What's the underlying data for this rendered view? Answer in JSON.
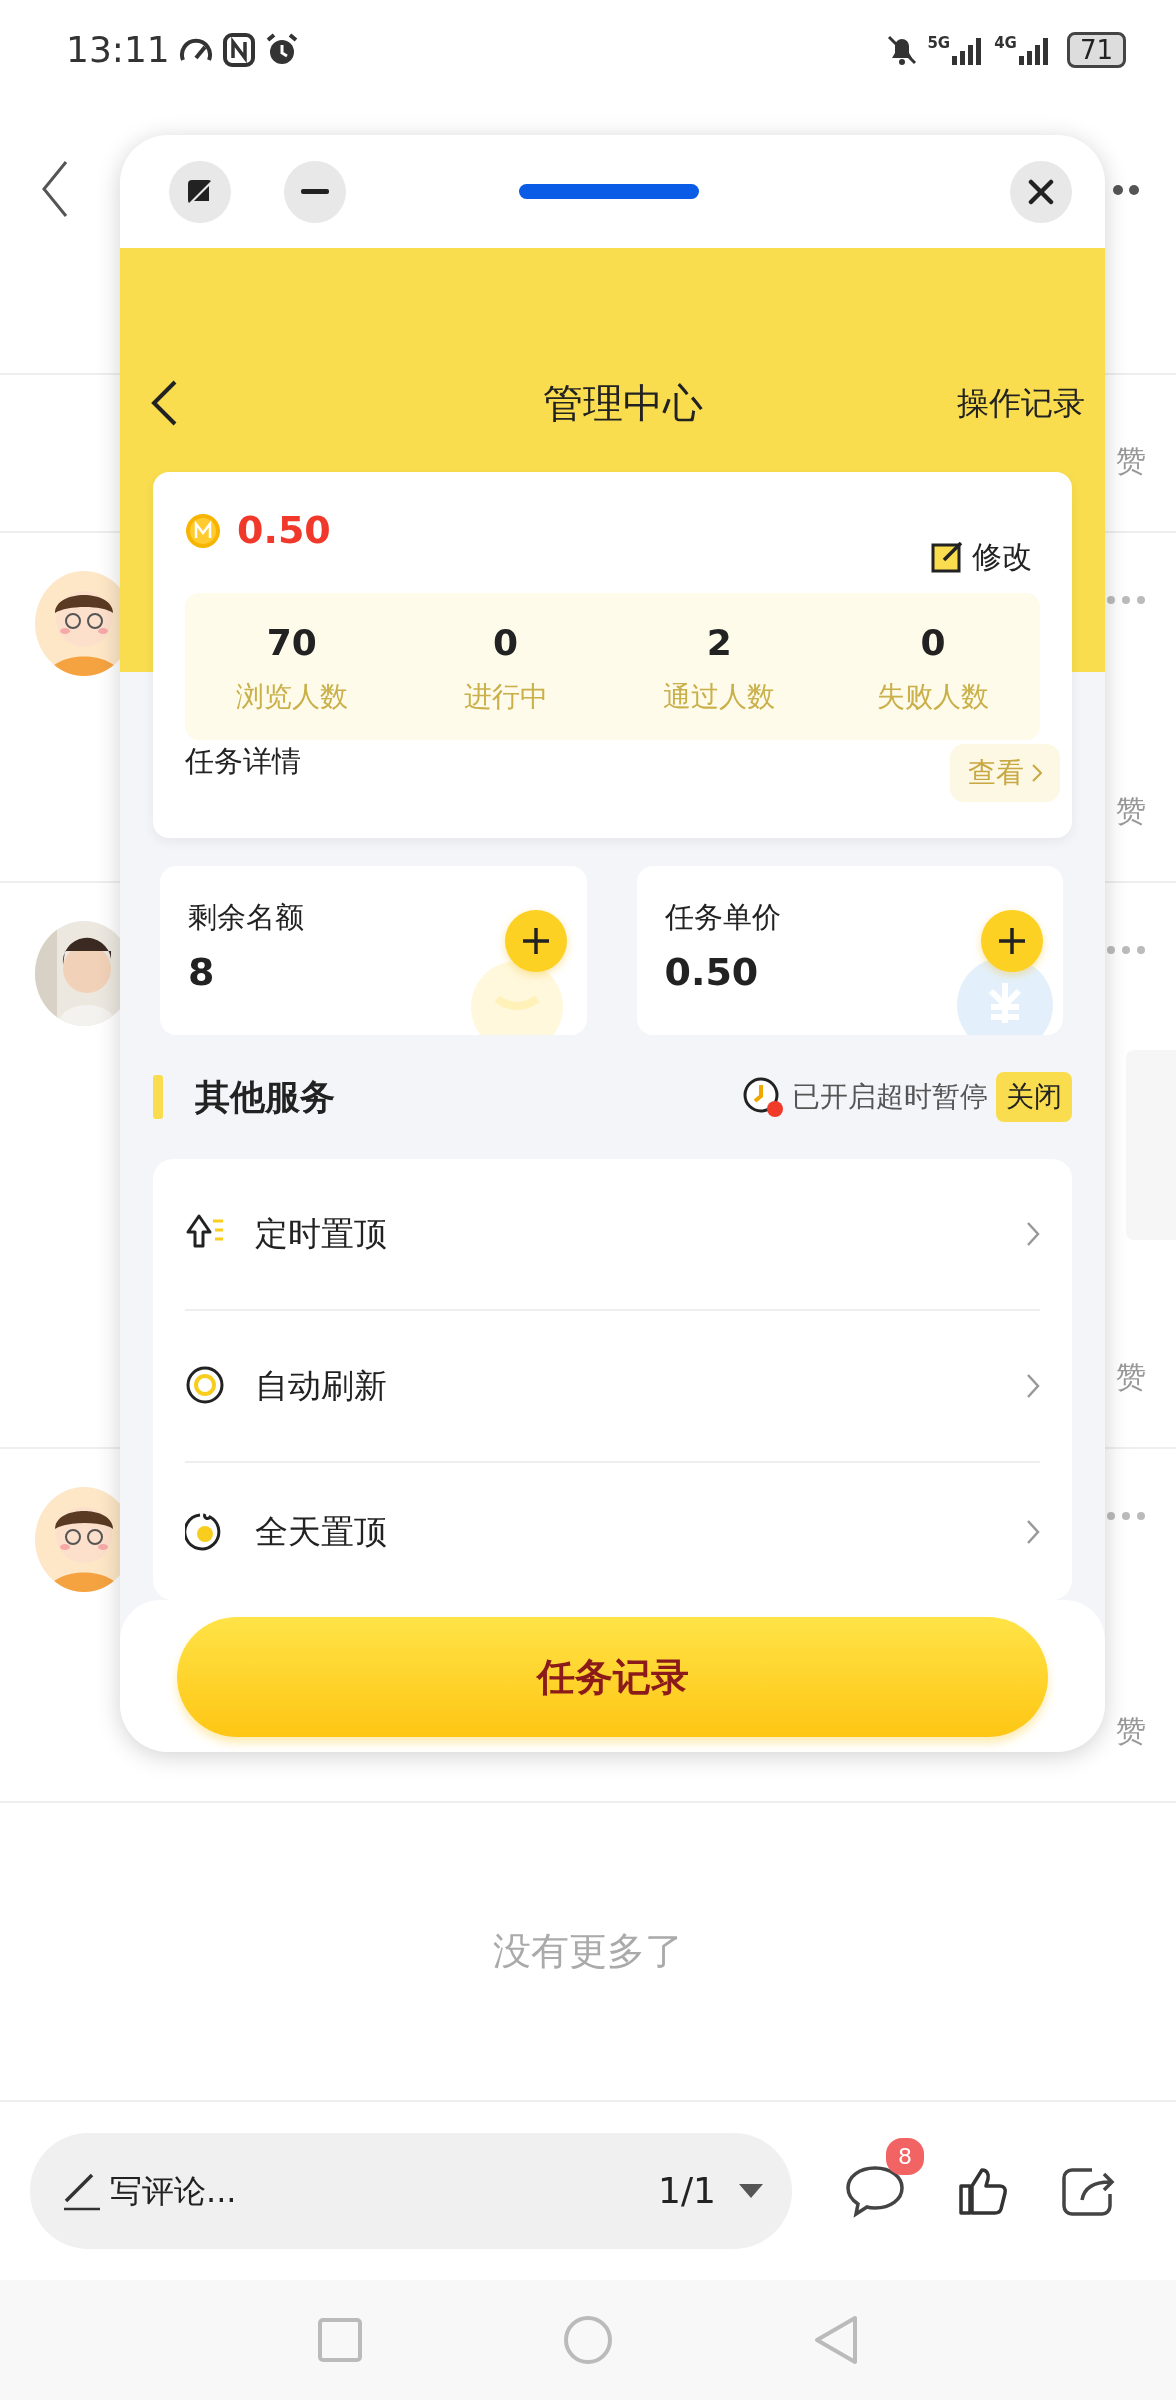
{
  "status_bar": {
    "time": "13:11",
    "network_1": "5G",
    "network_2": "4G",
    "battery": "71"
  },
  "page": {
    "posts": [
      {
        "kind": "plain",
        "like": "赞"
      },
      {
        "kind": "avatar",
        "like": "赞"
      },
      {
        "kind": "avatar",
        "like": "赞"
      },
      {
        "kind": "avatar",
        "like": "赞"
      }
    ],
    "end_text": "没有更多了"
  },
  "comment_bar": {
    "placeholder": "写评论...",
    "page": "1/1",
    "comment_count": "8"
  },
  "floating_window": {
    "title": "管理中心",
    "action": "操作记录",
    "price": "0.50",
    "edit_label": "修改",
    "stats": [
      {
        "value": "70",
        "label": "浏览人数"
      },
      {
        "value": "0",
        "label": "进行中"
      },
      {
        "value": "2",
        "label": "通过人数"
      },
      {
        "value": "0",
        "label": "失败人数"
      }
    ],
    "details_label": "任务详情",
    "view_label": "查看",
    "tiles": [
      {
        "label": "剩余名额",
        "value": "8"
      },
      {
        "label": "任务单价",
        "value": "0.50"
      }
    ],
    "section_title": "其他服务",
    "timeout_status": "已开启超时暂停",
    "timeout_action": "关闭",
    "services": [
      {
        "kind": "scheduled",
        "label": "定时置顶"
      },
      {
        "kind": "refresh",
        "label": "自动刷新"
      },
      {
        "kind": "allday",
        "label": "全天置顶"
      }
    ],
    "primary_button": "任务记录"
  }
}
